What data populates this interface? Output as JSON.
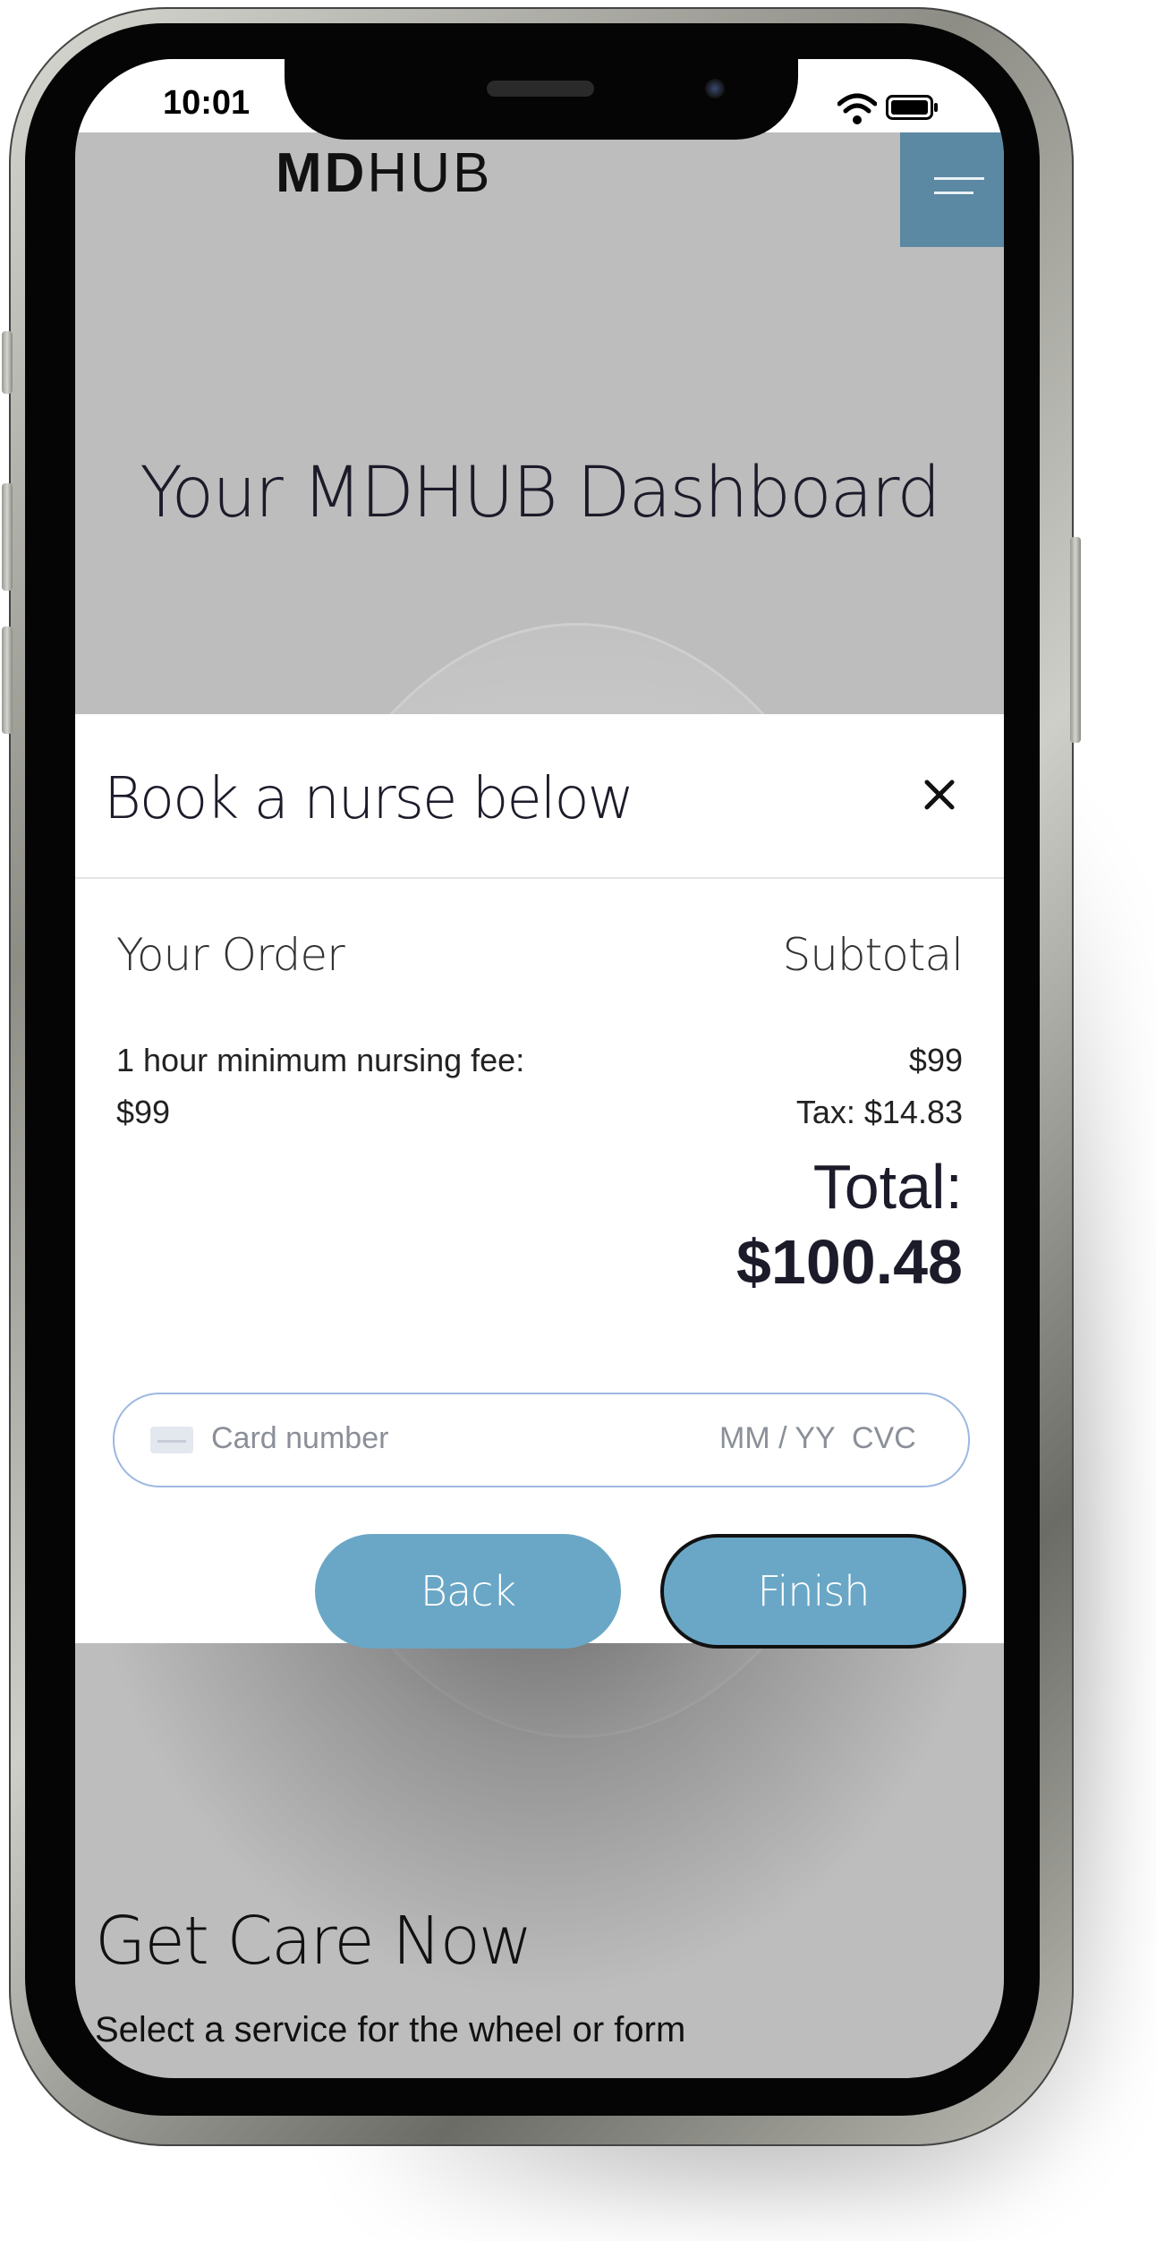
{
  "status_bar": {
    "time": "10:01"
  },
  "header": {
    "logo_bold": "MD",
    "logo_light": "HUB"
  },
  "dashboard": {
    "title": "Your MDHUB Dashboard"
  },
  "modal": {
    "title": "Book a nurse below",
    "close_symbol": "×",
    "order_label": "Your Order",
    "subtotal_label": "Subtotal",
    "item_name": "1 hour minimum nursing fee:",
    "item_price": "$99",
    "subtotal_amount": "$99",
    "tax": "Tax: $14.83",
    "total_label": "Total:",
    "total_value": "$100.48",
    "card": {
      "number_placeholder": "Card number",
      "expiry_placeholder": "MM / YY",
      "cvc_placeholder": "CVC"
    },
    "back_label": "Back",
    "finish_label": "Finish"
  },
  "page": {
    "section_title": "Get Care Now",
    "section_subtitle": "Select a service for the wheel or form"
  },
  "colors": {
    "accent": "#6aa7c6",
    "menu_bg": "#5b88a2",
    "overlay_bg": "#bdbdbd",
    "card_border": "#9db8e0"
  },
  "icons": [
    "wifi-icon",
    "battery-icon",
    "hamburger-menu-icon",
    "close-icon",
    "credit-card-icon"
  ]
}
